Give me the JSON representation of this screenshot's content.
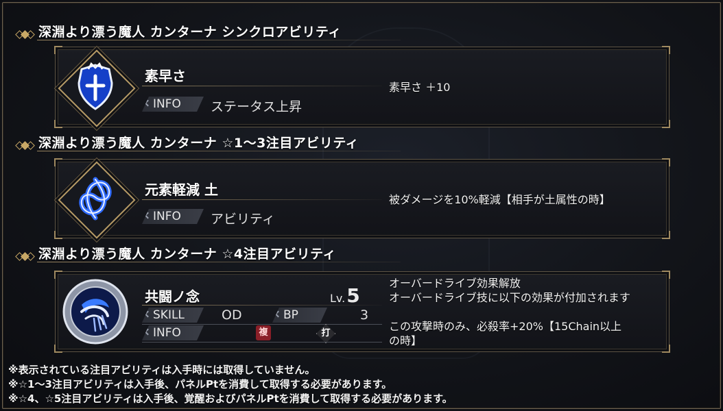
{
  "sections": [
    {
      "header": "深淵より漂う魔人 カンターナ シンクロアビリティ",
      "ability": {
        "icon": "shield-crest-icon",
        "name": "素早さ",
        "info_label": "INFO",
        "info_value": "ステータス上昇",
        "description": [
          "素早さ ＋10"
        ]
      }
    },
    {
      "header": "深淵より漂う魔人 カンターナ ☆1～3注目アビリティ",
      "ability": {
        "icon": "triquetra-knot-icon",
        "name": "元素軽減 土",
        "info_label": "INFO",
        "info_value": "アビリティ",
        "description": [
          "被ダメージを10%軽減【相手が土属性の時】"
        ]
      }
    },
    {
      "header": "深淵より漂う魔人 カンターナ ☆4注目アビリティ",
      "ability": {
        "icon": "wind-orb-icon",
        "name": "共闘ノ念",
        "level_label": "Lv.",
        "level_value": "5",
        "skill_label": "SKILL",
        "skill_value": "OD",
        "bp_label": "BP",
        "bp_value": "3",
        "info_label": "INFO",
        "badge_multi": "複",
        "badge_strike": "打",
        "description": [
          "オーバードライブ効果解放",
          "オーバードライブ技に以下の効果が付加されます",
          "",
          "この攻撃時のみ、必殺率+20%【15Chain以上",
          "の時】"
        ]
      }
    }
  ],
  "footnotes": [
    "※表示されている注目アビリティは入手時には取得していません。",
    "※☆1～3注目アビリティは入手後、パネルPtを消費して取得する必要があります。",
    "※☆4、☆5注目アビリティは入手後、覚醒およびパネルPtを消費して取得する必要があります。"
  ],
  "colors": {
    "gold_accent": "#c8a866",
    "icon_blue": "#2f6bff",
    "badge_red": "#8a1f28"
  }
}
